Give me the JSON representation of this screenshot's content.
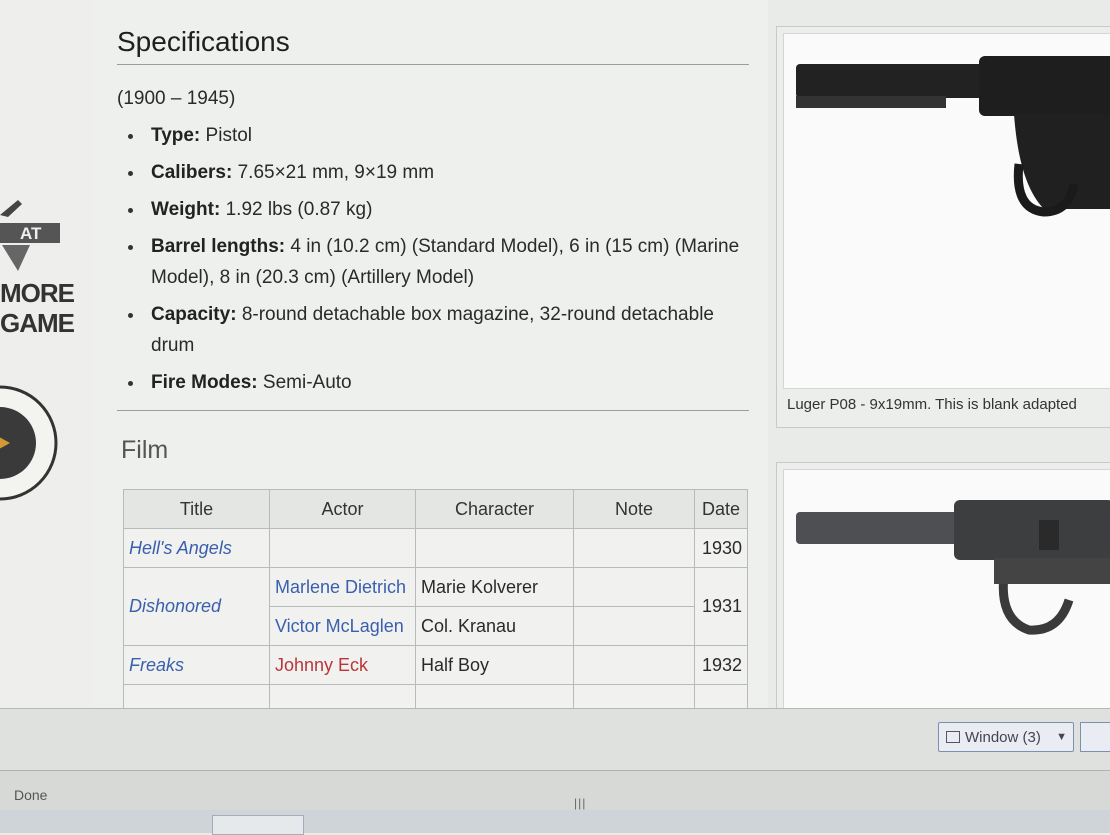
{
  "ad": {
    "line1": "MORE",
    "line2": "GAME"
  },
  "specs": {
    "heading": "Specifications",
    "years": "(1900 – 1945)",
    "items": [
      {
        "label": "Type:",
        "value": "Pistol"
      },
      {
        "label": "Calibers:",
        "value": "7.65×21 mm, 9×19 mm"
      },
      {
        "label": "Weight:",
        "value": "1.92 lbs (0.87 kg)"
      },
      {
        "label": "Barrel lengths:",
        "value": "4 in (10.2 cm) (Standard Model), 6 in (15 cm) (Marine Model), 8 in (20.3 cm) (Artillery Model)"
      },
      {
        "label": "Capacity:",
        "value": "8-round detachable box magazine, 32-round detachable drum"
      },
      {
        "label": "Fire Modes:",
        "value": "Semi-Auto"
      }
    ]
  },
  "film": {
    "heading": "Film",
    "headers": [
      "Title",
      "Actor",
      "Character",
      "Note",
      "Date"
    ],
    "rows": [
      {
        "title": "Hell's Angels",
        "date": "1930"
      },
      {
        "title": "Dishonored",
        "date": "1931",
        "actors": [
          "Marlene Dietrich",
          "Victor McLaglen"
        ],
        "characters": [
          "Marie Kolverer",
          "Col. Kranau"
        ]
      },
      {
        "title": "Freaks",
        "date": "1932",
        "actor": "Johnny Eck",
        "character": "Half Boy"
      }
    ]
  },
  "images": {
    "caption1": "Luger P08 - 9x19mm. This is blank adapted"
  },
  "chrome": {
    "window_label": "Window (3)",
    "status": "Done",
    "grip": "|||"
  }
}
